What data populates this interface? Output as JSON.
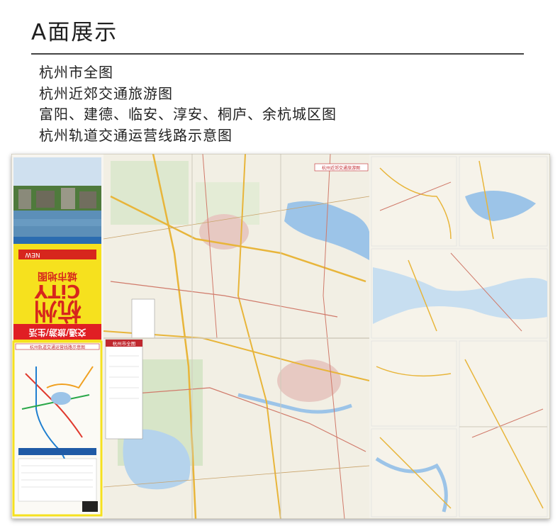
{
  "page": {
    "heading": "A面展示",
    "contents": [
      "杭州市全图",
      "杭州近郊交通旅游图",
      "富阳、建德、临安、淳安、桐庐、余杭城区图",
      "杭州轨道交通运营线路示意图"
    ]
  },
  "map": {
    "cover": {
      "title_zh": "杭州",
      "title_en": "CiTY",
      "subtitle_zh": "城市地图",
      "series": "交通/旅游/生活",
      "badge": "NEW"
    },
    "panel_labels": {
      "main_map": "杭州市全图",
      "suburb_map": "杭州近郊交通旅游图",
      "metro_header": "杭州轨道交通运营线路示意图"
    },
    "colors": {
      "water": "#9cc4e8",
      "land": "#f2efe4",
      "road_major": "#e8b53a",
      "road_minor": "#d07a6a",
      "cover_yellow": "#f6e11e",
      "cover_red": "#d7261d",
      "label_red": "#c0282e"
    }
  }
}
